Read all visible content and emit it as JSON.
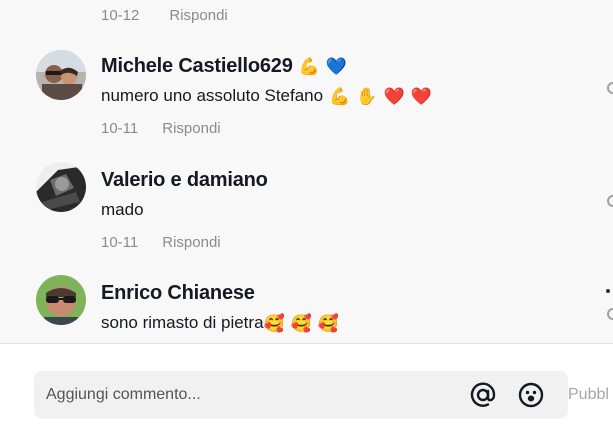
{
  "comments": [
    {
      "date": "10-12",
      "reply_label": "Rispondi"
    },
    {
      "author": "Michele Castiello629",
      "author_emojis": [
        "💪",
        "💙"
      ],
      "text": "numero uno assoluto Stefano",
      "text_emojis": [
        "💪",
        "✋",
        "❤️",
        "❤️"
      ],
      "date": "10-11",
      "reply_label": "Rispondi"
    },
    {
      "author": "Valerio e damiano",
      "text": "mado",
      "date": "10-11",
      "reply_label": "Rispondi"
    },
    {
      "author": "Enrico Chianese",
      "text": "sono rimasto di pietra",
      "text_emojis": [
        "🥰",
        "🥰",
        "🥰"
      ]
    }
  ],
  "composer": {
    "placeholder": "Aggiungi commento...",
    "post_label": "Pubbl"
  },
  "icons": {
    "mention": "at-sign-icon",
    "emoji": "emoji-face-icon"
  }
}
